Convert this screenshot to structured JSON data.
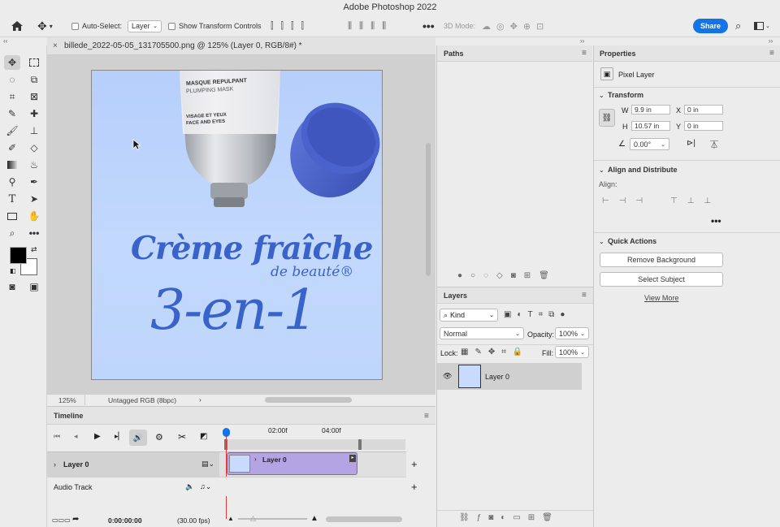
{
  "app": {
    "title": "Adobe Photoshop 2022"
  },
  "options": {
    "auto_select_label": "Auto-Select:",
    "auto_select_value": "Layer",
    "show_transform_label": "Show Transform Controls",
    "mode_3d_label": "3D Mode:",
    "share_label": "Share"
  },
  "document": {
    "tab_title": "billede_2022-05-05_131705500.png @ 125% (Layer 0, RGB/8#) *",
    "zoom": "125%",
    "profile": "Untagged RGB (8bpc)"
  },
  "artwork": {
    "tube_line1": "MASQUE REPULPANT",
    "tube_line2": "PLUMPING MASK",
    "tube_line3": "VISAGE ET YEUX",
    "tube_line4": "FACE AND EYES",
    "headline1": "Crème fraîche",
    "headline2": "de beauté®",
    "headline3": "3-en-1"
  },
  "timeline": {
    "title": "Timeline",
    "time_marks": [
      "02:00f",
      "04:00f"
    ],
    "layer_track": "Layer 0",
    "clip_label": "Layer 0",
    "audio_track": "Audio Track",
    "current_time": "0:00:00:00",
    "fps": "(30.00 fps)"
  },
  "paths": {
    "title": "Paths"
  },
  "layers": {
    "title": "Layers",
    "filter_kind": "Kind",
    "blend_mode": "Normal",
    "opacity_label": "Opacity:",
    "opacity_value": "100%",
    "lock_label": "Lock:",
    "fill_label": "Fill:",
    "fill_value": "100%",
    "layer_name": "Layer 0"
  },
  "properties": {
    "title": "Properties",
    "kind": "Pixel Layer",
    "transform_title": "Transform",
    "w_label": "W",
    "w_value": "9.9 in",
    "x_label": "X",
    "x_value": "0 in",
    "h_label": "H",
    "h_value": "10.57 in",
    "y_label": "Y",
    "y_value": "0 in",
    "angle_value": "0.00°",
    "align_title": "Align and Distribute",
    "align_label": "Align:",
    "quick_title": "Quick Actions",
    "remove_bg": "Remove Background",
    "select_subject": "Select Subject",
    "view_more": "View More"
  },
  "colors": {
    "accent": "#1473e6",
    "clip": "#b5a4e3",
    "brand_blue": "#3a63c9",
    "canvas_bg": "#bcd4fc"
  }
}
